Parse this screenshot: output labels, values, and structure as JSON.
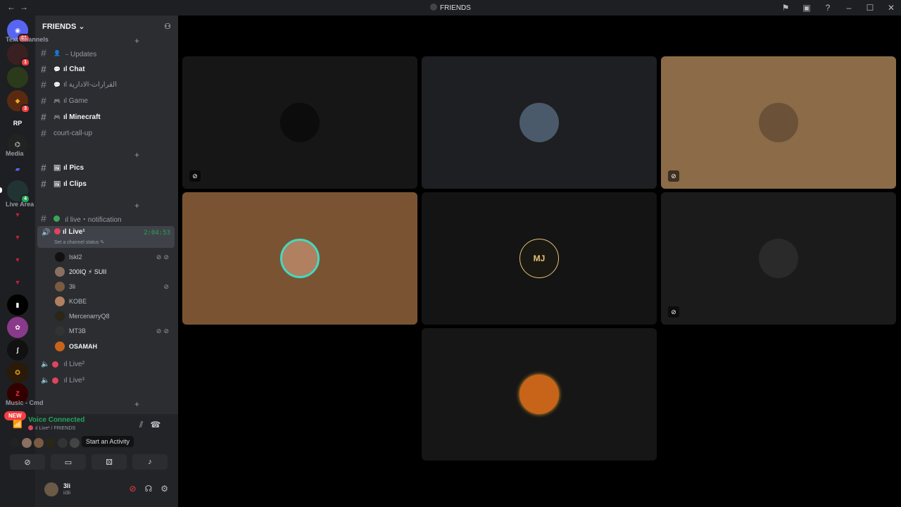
{
  "window": {
    "title": "FRIENDS",
    "nav_back": "←",
    "nav_fwd": "→"
  },
  "servers": [
    {
      "abbr": "",
      "badge": "61"
    },
    {
      "abbr": "",
      "badge": "1"
    },
    {
      "abbr": "",
      "badge": ""
    },
    {
      "abbr": "",
      "badge": "3"
    },
    {
      "abbr": "RP",
      "badge": ""
    },
    {
      "abbr": "",
      "badge": ""
    },
    {
      "abbr": "",
      "badge": ""
    },
    {
      "abbr": "",
      "badge": "4"
    }
  ],
  "server_new_label": "NEW",
  "guild": {
    "name": "FRIENDS"
  },
  "categories": {
    "text": "Text Channels",
    "media": "Media",
    "live": "Live Area",
    "music": "Music - Cmd"
  },
  "text_channels": [
    {
      "label": "﹣Updates"
    },
    {
      "label": "ıl Chat"
    },
    {
      "label": "ıl القرارات-الادارية"
    },
    {
      "label": "ıl Game"
    },
    {
      "label": "ıl Minecraft"
    },
    {
      "label": "court-call-up"
    }
  ],
  "media_channels": [
    {
      "label": "ıl Pics"
    },
    {
      "label": "ıl Clips"
    }
  ],
  "live_text_channel": "ıl live・notification",
  "active_voice": {
    "name": "ıl Live¹",
    "duration": "2:04:53",
    "status_placeholder": "Set a channel status"
  },
  "voice_users": [
    {
      "name": "Iskl2"
    },
    {
      "name": "200IQ ⚡ SUII"
    },
    {
      "name": "3li"
    },
    {
      "name": "KOBE"
    },
    {
      "name": "MercenarryQ8"
    },
    {
      "name": "MT3B"
    },
    {
      "name": "OSAMAH"
    }
  ],
  "other_voice": [
    {
      "name": "ıl Live²"
    },
    {
      "name": "ıl Live³"
    }
  ],
  "voice_panel": {
    "status": "Voice Connected",
    "channel": "ıl Live¹ / FRIENDS",
    "tooltip": "Start an Activity"
  },
  "user": {
    "name": "3li",
    "tag": "ii3li"
  },
  "colors": {
    "accent": "#23a559",
    "danger": "#f23f42",
    "live": "#e2435e"
  },
  "tiles": [
    {
      "bg": "#161616",
      "avatar": "#0c0c0c",
      "muted": true
    },
    {
      "bg": "#1e1f22",
      "avatar": "#4a5a6a",
      "muted": false
    },
    {
      "bg": "#8b6b48",
      "avatar": "#6a5138",
      "muted": true
    },
    {
      "bg": "#7a5432",
      "avatar": "#b08060",
      "muted": false
    },
    {
      "bg": "#141414",
      "avatar": "#1a1812",
      "muted": false,
      "monogram": "MJ"
    },
    {
      "bg": "#1b1b1b",
      "avatar": "#2a2a2a",
      "muted": true
    },
    {
      "bg": "#161616",
      "avatar": "#c8641a",
      "muted": false
    }
  ]
}
